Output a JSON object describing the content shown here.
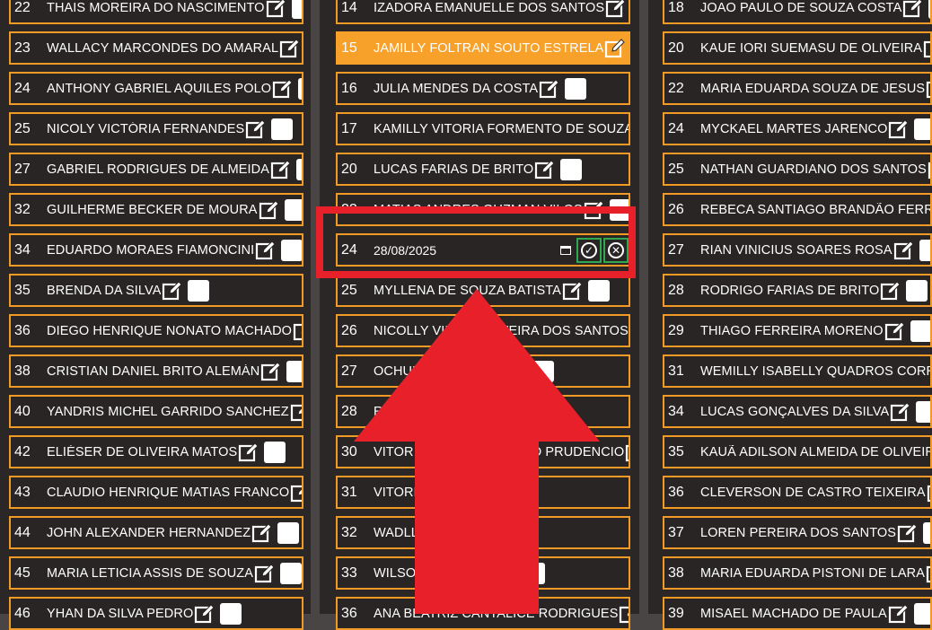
{
  "columns": [
    {
      "rows": [
        {
          "num": "22",
          "name": "THAIS MOREIRA DO NASCIMENTO"
        },
        {
          "num": "23",
          "name": "WALLACY MARCONDES DO AMARAL"
        },
        {
          "num": "24",
          "name": "ANTHONY GABRIEL AQUILES POLO"
        },
        {
          "num": "25",
          "name": "NICOLY VICTÓRIA FERNANDES"
        },
        {
          "num": "27",
          "name": "GABRIEL RODRIGUES DE ALMEIDA"
        },
        {
          "num": "32",
          "name": "GUILHERME BECKER DE MOURA"
        },
        {
          "num": "34",
          "name": "EDUARDO MORAES FIAMONCINI"
        },
        {
          "num": "35",
          "name": "BRENDA DA SILVA"
        },
        {
          "num": "36",
          "name": "DIEGO HENRIQUE NONATO MACHADO"
        },
        {
          "num": "38",
          "name": "CRISTIAN DANIEL BRITO ALEMÁN"
        },
        {
          "num": "40",
          "name": "YANDRIS MICHEL GARRIDO SANCHEZ"
        },
        {
          "num": "42",
          "name": "ELIÉSER DE OLIVEIRA MATOS"
        },
        {
          "num": "43",
          "name": "CLAUDIO HENRIQUE MATIAS FRANCO"
        },
        {
          "num": "44",
          "name": "JOHN ALEXANDER HERNANDEZ"
        },
        {
          "num": "45",
          "name": "MARIA LETICIA ASSIS DE SOUZA"
        },
        {
          "num": "46",
          "name": "YHAN DA SILVA PEDRO"
        }
      ]
    },
    {
      "rows": [
        {
          "num": "14",
          "name": "IZADORA EMANUELLE DOS SANTOS"
        },
        {
          "num": "15",
          "name": "JAMILLY FOLTRAN SOUTO ESTRELA"
        },
        {
          "num": "16",
          "name": "JULIA MENDES DA COSTA"
        },
        {
          "num": "17",
          "name": "KAMILLY VITORIA FORMENTO DE SOUZA"
        },
        {
          "num": "20",
          "name": "LUCAS FARIAS DE BRITO"
        },
        {
          "num": "22",
          "name": "MATIAS ANDRES GUZMAN VILOS"
        },
        {
          "num": "24",
          "date": "28/08/2025"
        },
        {
          "num": "25",
          "name": "MYLLENA DE SOUZA BATISTA"
        },
        {
          "num": "26",
          "name": "NICOLLY VIEIRA OLIVEIRA DOS SANTOS"
        },
        {
          "num": "27",
          "name": "OCHUN FERNANDEZ"
        },
        {
          "num": "28",
          "name": "RE"
        },
        {
          "num": "30",
          "name": "VITOR  DE SOUZA RIBEIRO PRUDENCIO"
        },
        {
          "num": "31",
          "name": "VITORIA"
        },
        {
          "num": "32",
          "name": "WADLL"
        },
        {
          "num": "33",
          "name": "WILSON DE SOUZA"
        },
        {
          "num": "36",
          "name": "ANA BEATRIZ CANTALICE RODRIGUES"
        }
      ]
    },
    {
      "rows": [
        {
          "num": "18",
          "name": "JOAO PAULO DE SOUZA COSTA"
        },
        {
          "num": "20",
          "name": "KAUE IORI SUEMASU DE OLIVEIRA"
        },
        {
          "num": "22",
          "name": "MARIA EDUARDA SOUZA DE JESUS"
        },
        {
          "num": "24",
          "name": "MYCKAEL MARTES JARENCO"
        },
        {
          "num": "25",
          "name": "NATHAN GUARDIANO DOS SANTOS"
        },
        {
          "num": "26",
          "name": "REBECA SANTIAGO BRANDÃO FERREIRA"
        },
        {
          "num": "27",
          "name": "RIAN VINICIUS SOARES ROSA"
        },
        {
          "num": "28",
          "name": "RODRIGO FARIAS DE BRITO"
        },
        {
          "num": "29",
          "name": "THIAGO FERREIRA MORENO"
        },
        {
          "num": "31",
          "name": "WEMILLY ISABELLY QUADROS CORREA"
        },
        {
          "num": "34",
          "name": "LUCAS GONÇALVES DA SILVA"
        },
        {
          "num": "35",
          "name": "KAUÃ ADILSON ALMEIDA DE OLIVEIRA"
        },
        {
          "num": "36",
          "name": "CLEVERSON DE CASTRO TEIXEIRA"
        },
        {
          "num": "37",
          "name": "LOREN PEREIRA DOS SANTOS"
        },
        {
          "num": "38",
          "name": "MARIA EDUARDA PISTONI DE LARA"
        },
        {
          "num": "39",
          "name": "MISAEL MACHADO DE PAULA"
        }
      ]
    }
  ],
  "colors": {
    "accent": "#f29a26",
    "highlight": "#f7a12a",
    "annotation": "#e8202a",
    "confirm": "#2fa84f"
  }
}
